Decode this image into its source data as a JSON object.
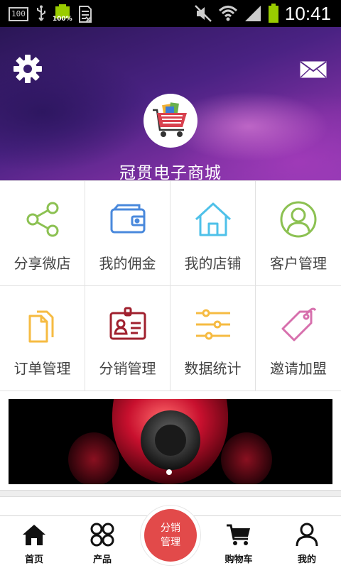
{
  "status_bar": {
    "indicator_box": "100",
    "battery_level": "100%",
    "time": "10:41"
  },
  "header": {
    "shop_name": "冠贯电子商城"
  },
  "menu": [
    {
      "label": "分享微店",
      "icon": "share-icon",
      "color": "#8cc152"
    },
    {
      "label": "我的佣金",
      "icon": "wallet-icon",
      "color": "#4a89dc"
    },
    {
      "label": "我的店铺",
      "icon": "home-icon",
      "color": "#4fc1e9"
    },
    {
      "label": "客户管理",
      "icon": "user-circle-icon",
      "color": "#8cc152"
    },
    {
      "label": "订单管理",
      "icon": "documents-icon",
      "color": "#f6bb42"
    },
    {
      "label": "分销管理",
      "icon": "id-card-icon",
      "color": "#a0202e"
    },
    {
      "label": "数据统计",
      "icon": "sliders-icon",
      "color": "#f6bb42"
    },
    {
      "label": "邀请加盟",
      "icon": "tag-icon",
      "color": "#d770ad"
    }
  ],
  "bottom_nav": {
    "home": "首页",
    "products": "产品",
    "center_line1": "分销",
    "center_line2": "管理",
    "cart": "购物车",
    "mine": "我的"
  }
}
